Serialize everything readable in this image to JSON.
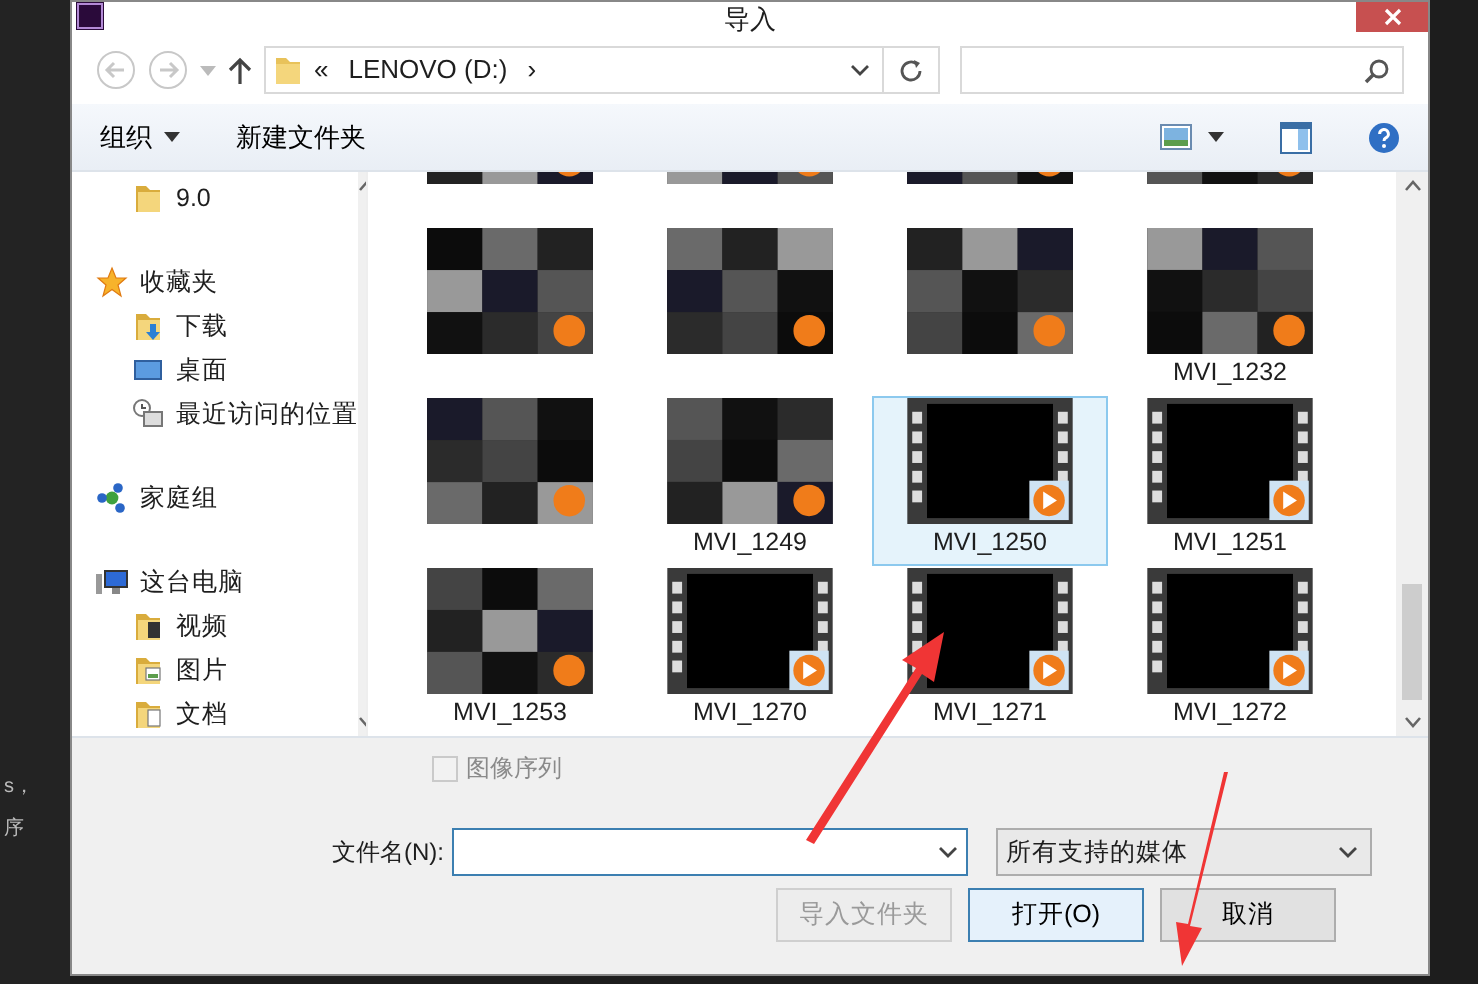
{
  "window": {
    "title": "导入",
    "app_texts": [
      "s，",
      "序"
    ]
  },
  "address": {
    "crumbs": [
      "«",
      "LENOVO (D:)",
      "›"
    ]
  },
  "toolbar": {
    "organize": "组织",
    "new_folder": "新建文件夹"
  },
  "nav": [
    {
      "children": [
        {
          "label": "9.0",
          "kind": "folder"
        }
      ]
    },
    {
      "label": "收藏夹",
      "kind": "star",
      "children": [
        {
          "label": "下载",
          "kind": "download"
        },
        {
          "label": "桌面",
          "kind": "desktop"
        },
        {
          "label": "最近访问的位置",
          "kind": "recent"
        }
      ]
    },
    {
      "label": "家庭组",
      "kind": "homegroup"
    },
    {
      "label": "这台电脑",
      "kind": "computer",
      "children": [
        {
          "label": "视频",
          "kind": "video-folder"
        },
        {
          "label": "图片",
          "kind": "picture-folder"
        },
        {
          "label": "文档",
          "kind": "doc-folder"
        }
      ]
    }
  ],
  "files": [
    {
      "kind": "mosaic",
      "selected": false
    },
    {
      "kind": "mosaic",
      "selected": false
    },
    {
      "kind": "mosaic",
      "selected": false
    },
    {
      "kind": "mosaic",
      "selected": false
    },
    {
      "kind": "mosaic",
      "selected": false
    },
    {
      "kind": "mosaic",
      "selected": false
    },
    {
      "kind": "mosaic",
      "selected": false
    },
    {
      "kind": "mosaic",
      "name": "MVI_1232",
      "selected": false
    },
    {
      "kind": "mosaic",
      "selected": false
    },
    {
      "kind": "mosaic",
      "name": "MVI_1249",
      "selected": false
    },
    {
      "kind": "film",
      "name": "MVI_1250",
      "selected": true
    },
    {
      "kind": "film",
      "name": "MVI_1251",
      "selected": false
    },
    {
      "kind": "mosaic",
      "name": "MVI_1253",
      "selected": false
    },
    {
      "kind": "film",
      "name": "MVI_1270",
      "selected": false
    },
    {
      "kind": "film",
      "name": "MVI_1271",
      "selected": false
    },
    {
      "kind": "film",
      "name": "MVI_1272",
      "selected": false
    }
  ],
  "image_sequence": {
    "label": "图像序列",
    "checked": false,
    "disabled": true
  },
  "filename": {
    "label": "文件名(N):"
  },
  "filter": "所有支持的媒体",
  "buttons": [
    {
      "label": "导入文件夹",
      "disabled": true,
      "primary": false
    },
    {
      "label": "打开(O)",
      "disabled": false,
      "primary": true
    },
    {
      "label": "取消",
      "disabled": false,
      "primary": false
    }
  ]
}
